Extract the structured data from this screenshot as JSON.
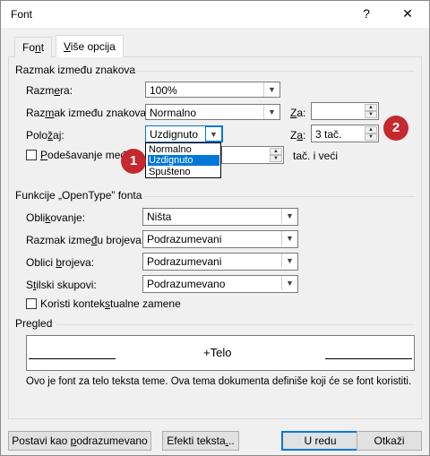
{
  "window": {
    "title": "Font",
    "help_glyph": "?",
    "close_glyph": "✕"
  },
  "tabs": [
    {
      "pre": "Fo",
      "key": "n",
      "post": "t"
    },
    {
      "pre": "",
      "key": "V",
      "post": "iše opcija"
    }
  ],
  "spacing": {
    "heading": "Razmak između znakova",
    "scale": {
      "pre": "Razm",
      "key": "e",
      "post": "ra:",
      "value": "100%"
    },
    "spacing": {
      "pre": "Raz",
      "key": "m",
      "post": "ak između znakova:",
      "value": "Normalno"
    },
    "by1": {
      "pre": "",
      "key": "Z",
      "post": "a:",
      "value": ""
    },
    "position": {
      "pre": "Polo",
      "key": "ž",
      "post": "aj:",
      "value": "Uzdignuto"
    },
    "by2": {
      "pre": "Z",
      "key": "a",
      "post": ":",
      "value": "3 tač."
    },
    "kerning": {
      "pre": "",
      "key": "P",
      "post": "odešavanje međ",
      "suffix": "tač. i veći"
    },
    "position_options": [
      "Normalno",
      "Uzdignuto",
      "Spušteno"
    ]
  },
  "opentype": {
    "heading": "Funkcije „OpenType” fonta",
    "ligatures": {
      "pre": "Obli",
      "key": "k",
      "post": "ovanje:",
      "value": "Ništa"
    },
    "number_spacing": {
      "pre": "Razmak izme",
      "key": "đ",
      "post": "u brojeva:",
      "value": "Podrazumevani"
    },
    "number_forms": {
      "pre": "Oblici ",
      "key": "b",
      "post": "rojeva:",
      "value": "Podrazumevani"
    },
    "stylistic_sets": {
      "pre": "S",
      "key": "t",
      "post": "ilski skupovi:",
      "value": "Podrazumevano"
    },
    "contextual": {
      "pre": "Koristi kontek",
      "key": "s",
      "post": "tualne zamene"
    }
  },
  "preview": {
    "heading": "Pregled",
    "sample": "+Telo",
    "description": "Ovo je font za telo teksta teme. Ova tema dokumenta definiše koji će se font koristiti."
  },
  "buttons": {
    "set_default": {
      "pre": "Postavi kao ",
      "key": "p",
      "post": "odrazumevano"
    },
    "text_effects": {
      "pre": "Efekti teksta",
      "key": ".",
      "post": ".."
    },
    "ok": {
      "pre": "U redu",
      "key": "",
      "post": ""
    },
    "cancel": {
      "pre": "Otkaži",
      "key": "",
      "post": ""
    }
  },
  "callouts": [
    "1",
    "2"
  ],
  "colors": {
    "accent": "#0078d7",
    "callout": "#c5282e"
  }
}
